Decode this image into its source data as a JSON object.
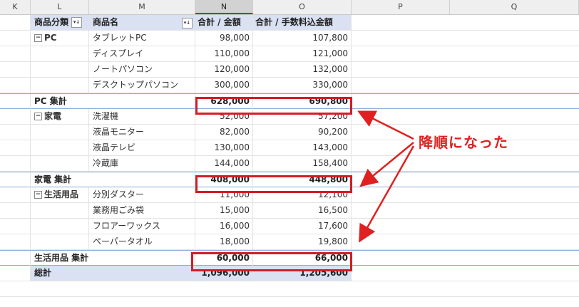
{
  "columns": [
    "K",
    "L",
    "M",
    "N",
    "O",
    "P",
    "Q"
  ],
  "header": {
    "category": "商品分類",
    "product": "商品名",
    "sum_amount": "合計 / 金額",
    "sum_fee": "合計 / 手数料込金額",
    "filter_icon_category": "▾↓",
    "filter_icon_product": "▾↓"
  },
  "rows": [
    {
      "type": "item",
      "category": "PC",
      "product": "タブレットPC",
      "amount": "98,000",
      "fee": "107,800"
    },
    {
      "type": "item",
      "category": "",
      "product": "ディスプレイ",
      "amount": "110,000",
      "fee": "121,000"
    },
    {
      "type": "item",
      "category": "",
      "product": "ノートパソコン",
      "amount": "120,000",
      "fee": "132,000"
    },
    {
      "type": "item",
      "category": "",
      "product": "デスクトップパソコン",
      "amount": "300,000",
      "fee": "330,000"
    },
    {
      "type": "subtotal",
      "category": "PC 集計",
      "amount": "628,000",
      "fee": "690,800"
    },
    {
      "type": "item",
      "category": "家電",
      "product": "洗濯機",
      "amount": "52,000",
      "fee": "57,200"
    },
    {
      "type": "item",
      "category": "",
      "product": "液晶モニター",
      "amount": "82,000",
      "fee": "90,200"
    },
    {
      "type": "item",
      "category": "",
      "product": "液晶テレビ",
      "amount": "130,000",
      "fee": "143,000"
    },
    {
      "type": "item",
      "category": "",
      "product": "冷蔵庫",
      "amount": "144,000",
      "fee": "158,400"
    },
    {
      "type": "subtotal",
      "category": "家電 集計",
      "amount": "408,000",
      "fee": "448,800"
    },
    {
      "type": "item",
      "category": "生活用品",
      "product": "分別ダスター",
      "amount": "11,000",
      "fee": "12,100"
    },
    {
      "type": "item",
      "category": "",
      "product": "業務用ごみ袋",
      "amount": "15,000",
      "fee": "16,500"
    },
    {
      "type": "item",
      "category": "",
      "product": "フロアーワックス",
      "amount": "16,000",
      "fee": "17,600"
    },
    {
      "type": "item",
      "category": "",
      "product": "ペーパータオル",
      "amount": "18,000",
      "fee": "19,800"
    },
    {
      "type": "subtotal",
      "category": "生活用品 集計",
      "amount": "60,000",
      "fee": "66,000"
    },
    {
      "type": "total",
      "category": "総計",
      "amount": "1,096,000",
      "fee": "1,205,600"
    }
  ],
  "collapse_symbol": "⊟",
  "annotation": "降順になった",
  "colors": {
    "highlight_box": "#d41c24",
    "annotation_text": "#e02020",
    "pivot_header_bg": "#d9e1f2"
  }
}
